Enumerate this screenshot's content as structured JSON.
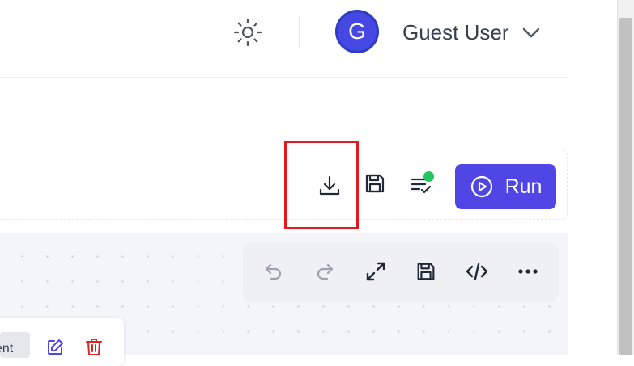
{
  "header": {
    "theme_toggle_icon": "sun-icon",
    "avatar_initial": "G",
    "user_name": "Guest User",
    "dropdown_icon": "chevron-down-icon"
  },
  "toolbar": {
    "download_icon": "download-icon",
    "save_icon": "save-icon",
    "checklist_icon": "list-check-icon",
    "status_dot_color": "#22c55e",
    "run_label": "Run",
    "run_icon": "play-circle-icon",
    "run_color": "#4f46e5"
  },
  "canvas_toolbar": {
    "buttons": [
      "undo-icon",
      "redo-icon",
      "expand-icon",
      "save-icon",
      "code-icon",
      "more-icon"
    ]
  },
  "node": {
    "pill_text": "ent",
    "edit_icon": "edit-icon",
    "delete_icon": "trash-icon"
  },
  "colors": {
    "highlight_box": "#e3191f",
    "accent": "#4f46e5"
  }
}
